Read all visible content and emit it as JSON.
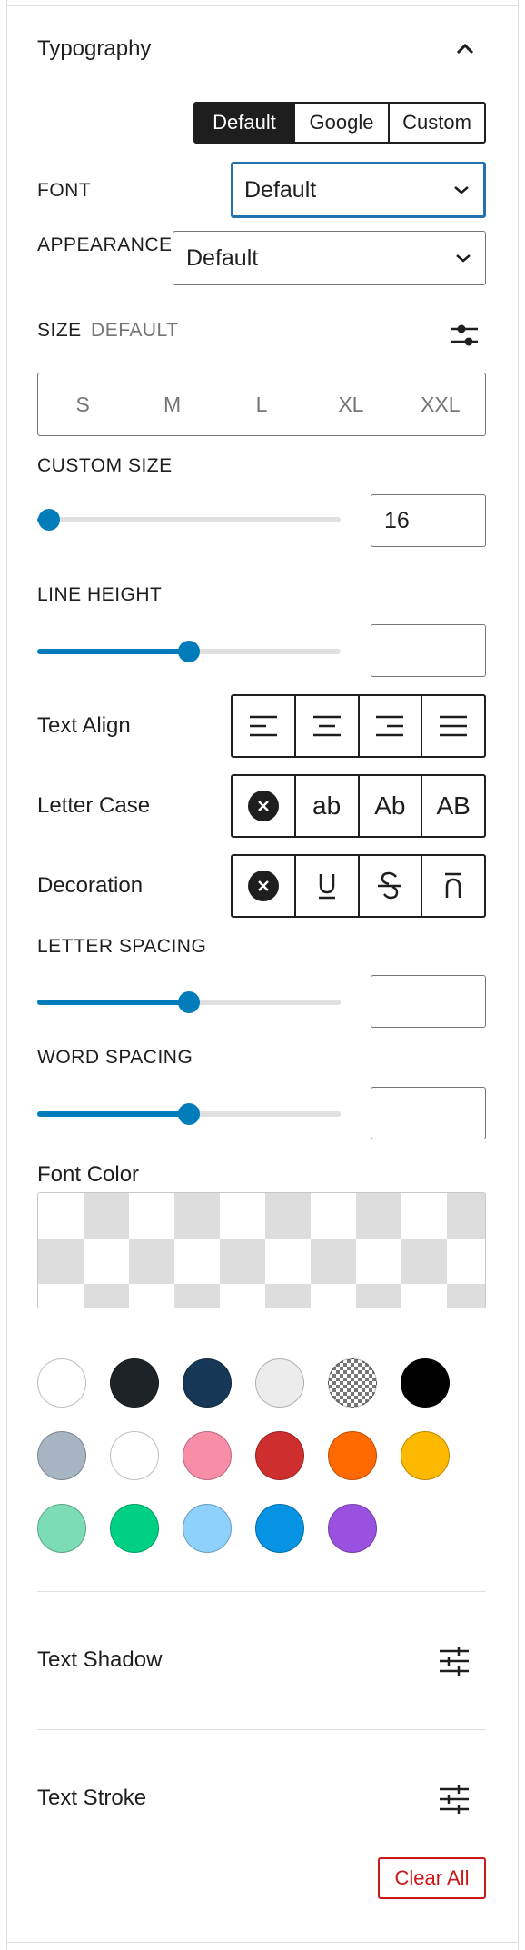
{
  "section": {
    "title": "Typography",
    "collapse_icon": "chevron-up-icon"
  },
  "font_source": {
    "options": [
      "Default",
      "Google",
      "Custom"
    ],
    "selected": "Default"
  },
  "font": {
    "label": "FONT",
    "value": "Default"
  },
  "appearance": {
    "label": "APPEARANCE",
    "value": "Default"
  },
  "size": {
    "label": "SIZE",
    "sublabel": "DEFAULT",
    "settings_icon": "sliders-icon",
    "options": [
      "S",
      "M",
      "L",
      "XL",
      "XXL"
    ]
  },
  "custom_size": {
    "label": "CUSTOM SIZE",
    "value": "16",
    "slider_fraction": 0.04
  },
  "line_height": {
    "label": "LINE HEIGHT",
    "value": "",
    "slider_fraction": 0.5
  },
  "text_align": {
    "label": "Text Align",
    "options": [
      "align-left-icon",
      "align-center-icon",
      "align-right-icon",
      "align-justify-icon"
    ]
  },
  "letter_case": {
    "label": "Letter Case",
    "options": [
      "none-icon",
      "ab",
      "Ab",
      "AB"
    ]
  },
  "decoration": {
    "label": "Decoration",
    "options": [
      "none-icon",
      "underline-icon",
      "strikethrough-icon",
      "overline-icon"
    ]
  },
  "letter_spacing": {
    "label": "LETTER SPACING",
    "value": "",
    "slider_fraction": 0.5
  },
  "word_spacing": {
    "label": "WORD SPACING",
    "value": "",
    "slider_fraction": 0.5
  },
  "font_color": {
    "label": "Font Color",
    "swatches": [
      "#ffffff",
      "#1d2327",
      "#163756",
      "#ececec",
      "transparent",
      "#000000",
      "#a7b4c1",
      "#ffffff",
      "#f78da7",
      "#cf2e2e",
      "#ff6900",
      "#fcb900",
      "#7bdcb5",
      "#00d084",
      "#8ed1fc",
      "#0693e3",
      "#9b51e0"
    ]
  },
  "text_shadow": {
    "label": "Text Shadow",
    "icon": "settings-sliders-icon"
  },
  "text_stroke": {
    "label": "Text Stroke",
    "icon": "settings-sliders-icon"
  },
  "clear_all": {
    "label": "Clear All"
  },
  "colors": {
    "accent": "#007cba",
    "focus": "#2271b1",
    "danger": "#cc1818",
    "dark": "#1e1e1e"
  }
}
